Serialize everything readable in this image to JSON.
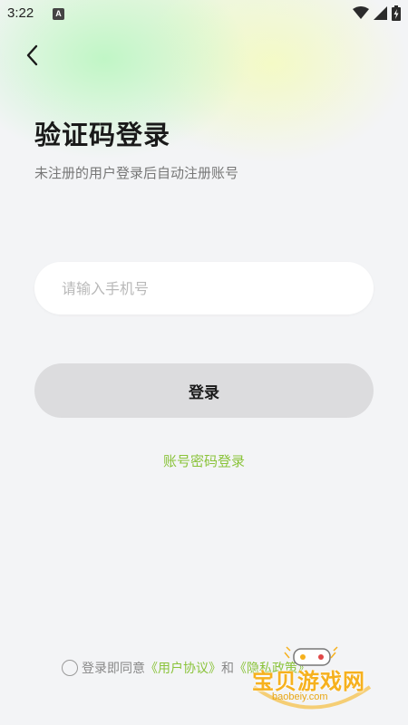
{
  "status_bar": {
    "time": "3:22",
    "notification_letter": "A",
    "icons": [
      "wifi-icon",
      "signal-icon",
      "battery-charging-icon"
    ]
  },
  "nav": {
    "back_icon": "chevron-left-icon"
  },
  "header": {
    "title": "验证码登录",
    "subtitle": "未注册的用户登录后自动注册账号"
  },
  "form": {
    "phone_placeholder": "请输入手机号",
    "phone_value": "",
    "login_label": "登录",
    "password_login_label": "账号密码登录"
  },
  "agreement": {
    "checked": false,
    "prefix": "登录即同意",
    "user_agreement": "《用户协议》",
    "conjunction": "和",
    "privacy_policy": "《隐私政策》"
  },
  "watermark": {
    "logo_text": "宝贝游戏网",
    "url": "baobeiy.com"
  },
  "colors": {
    "accent": "#8ac33a",
    "button_bg": "#dcdcde",
    "page_bg": "#f3f4f6",
    "watermark": "#f6b11e"
  }
}
